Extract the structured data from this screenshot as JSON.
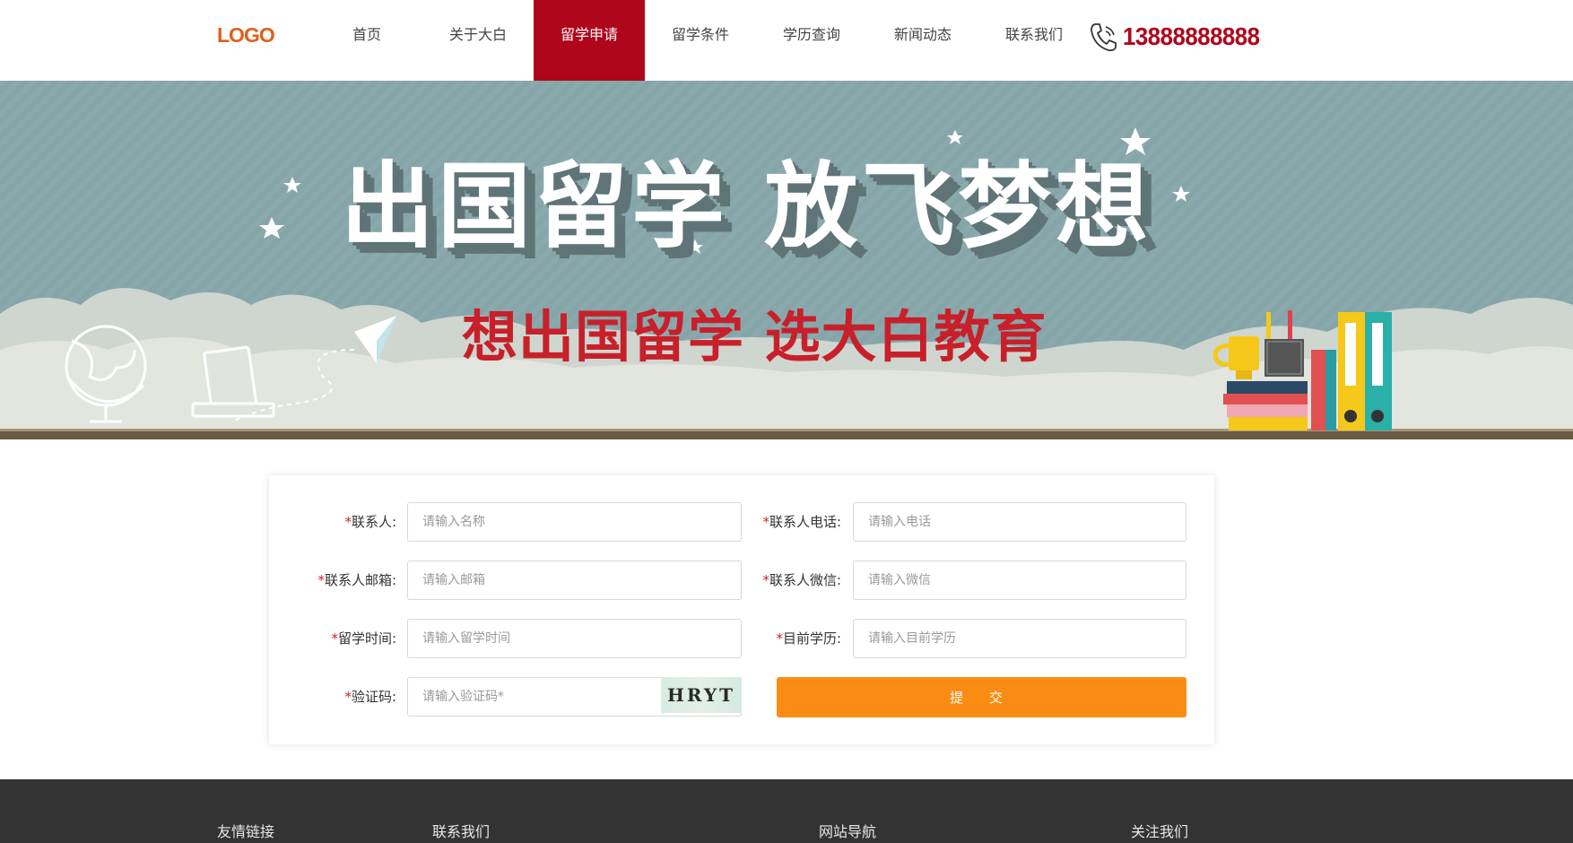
{
  "header": {
    "logo": "LOGO",
    "nav": [
      {
        "label": "首页",
        "active": false
      },
      {
        "label": "关于大白",
        "active": false
      },
      {
        "label": "留学申请",
        "active": true
      },
      {
        "label": "留学条件",
        "active": false
      },
      {
        "label": "学历查询",
        "active": false
      },
      {
        "label": "新闻动态",
        "active": false
      },
      {
        "label": "联系我们",
        "active": false
      }
    ],
    "phone_icon": "phone-icon",
    "phone": "13888888888"
  },
  "banner": {
    "title": "出国留学 放飞梦想",
    "subtitle": "想出国留学 选大白教育"
  },
  "form": {
    "contact": {
      "label": "联系人:",
      "placeholder": "请输入名称"
    },
    "phone": {
      "label": "联系人电话:",
      "placeholder": "请输入电话"
    },
    "email": {
      "label": "联系人邮箱:",
      "placeholder": "请输入邮箱"
    },
    "wechat": {
      "label": "联系人微信:",
      "placeholder": "请输入微信"
    },
    "study_time": {
      "label": "留学时间:",
      "placeholder": "请输入留学时间"
    },
    "education": {
      "label": "目前学历:",
      "placeholder": "请输入目前学历"
    },
    "captcha": {
      "label": "验证码:",
      "placeholder": "请输入验证码*",
      "image_text": "HRYT"
    },
    "required_mark": "*",
    "submit": "提 交"
  },
  "footer": {
    "links": "友情链接",
    "contact": "联系我们",
    "sitemap": "网站导航",
    "follow": "关注我们"
  },
  "colors": {
    "brand_red": "#b0061c",
    "submit_orange": "#fb8c13",
    "banner_bg": "#8aa9ad",
    "footer_bg": "#333333"
  }
}
